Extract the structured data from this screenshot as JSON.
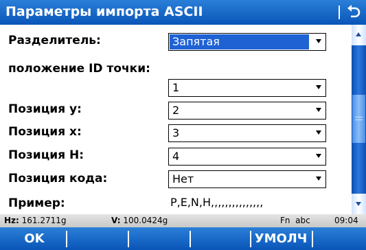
{
  "header": {
    "title": "Параметры импорта ASCII",
    "back_icon": "return-arrow-icon"
  },
  "form": {
    "separator": {
      "label": "Разделитель:",
      "value": "Запятая"
    },
    "point_id": {
      "label": "положение ID точки:",
      "value": "1"
    },
    "pos_y": {
      "label": "Позиция y:",
      "value": "2"
    },
    "pos_x": {
      "label": "Позиция x:",
      "value": "3"
    },
    "pos_h": {
      "label": "Позиция H:",
      "value": "4"
    },
    "pos_code": {
      "label": "Позиция кода:",
      "value": "Нет"
    },
    "example": {
      "label": "Пример:",
      "value": "P,E,N,H,,,,,,,,,,,,,,,"
    }
  },
  "status": {
    "hz_label": "Hz:",
    "hz_value": "161.2711g",
    "v_label": "V:",
    "v_value": "100.0424g",
    "mode": "Fn  abc",
    "time": "09:04"
  },
  "softkeys": {
    "ok": "OK",
    "default": "УМОЛЧ"
  },
  "colors": {
    "title_bar": "#0a55b8",
    "selection": "#1f62d4",
    "status_bar": "#d0d0d0"
  }
}
